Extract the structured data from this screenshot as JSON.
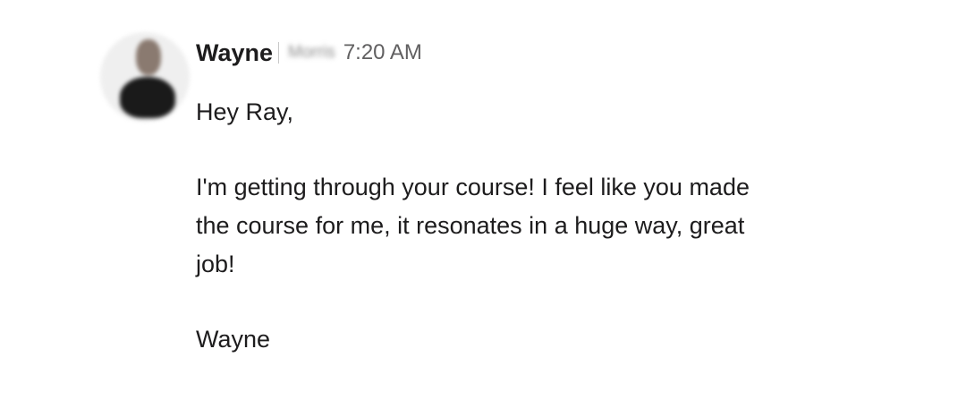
{
  "message": {
    "sender": "Wayne",
    "redacted_surname": "Morris",
    "timestamp": "7:20 AM",
    "greeting": "Hey Ray,",
    "body_lines": [
      "I'm getting through your course! I feel like you made",
      "the course for me, it resonates in a huge way, great",
      "job!"
    ],
    "signoff": "Wayne"
  }
}
